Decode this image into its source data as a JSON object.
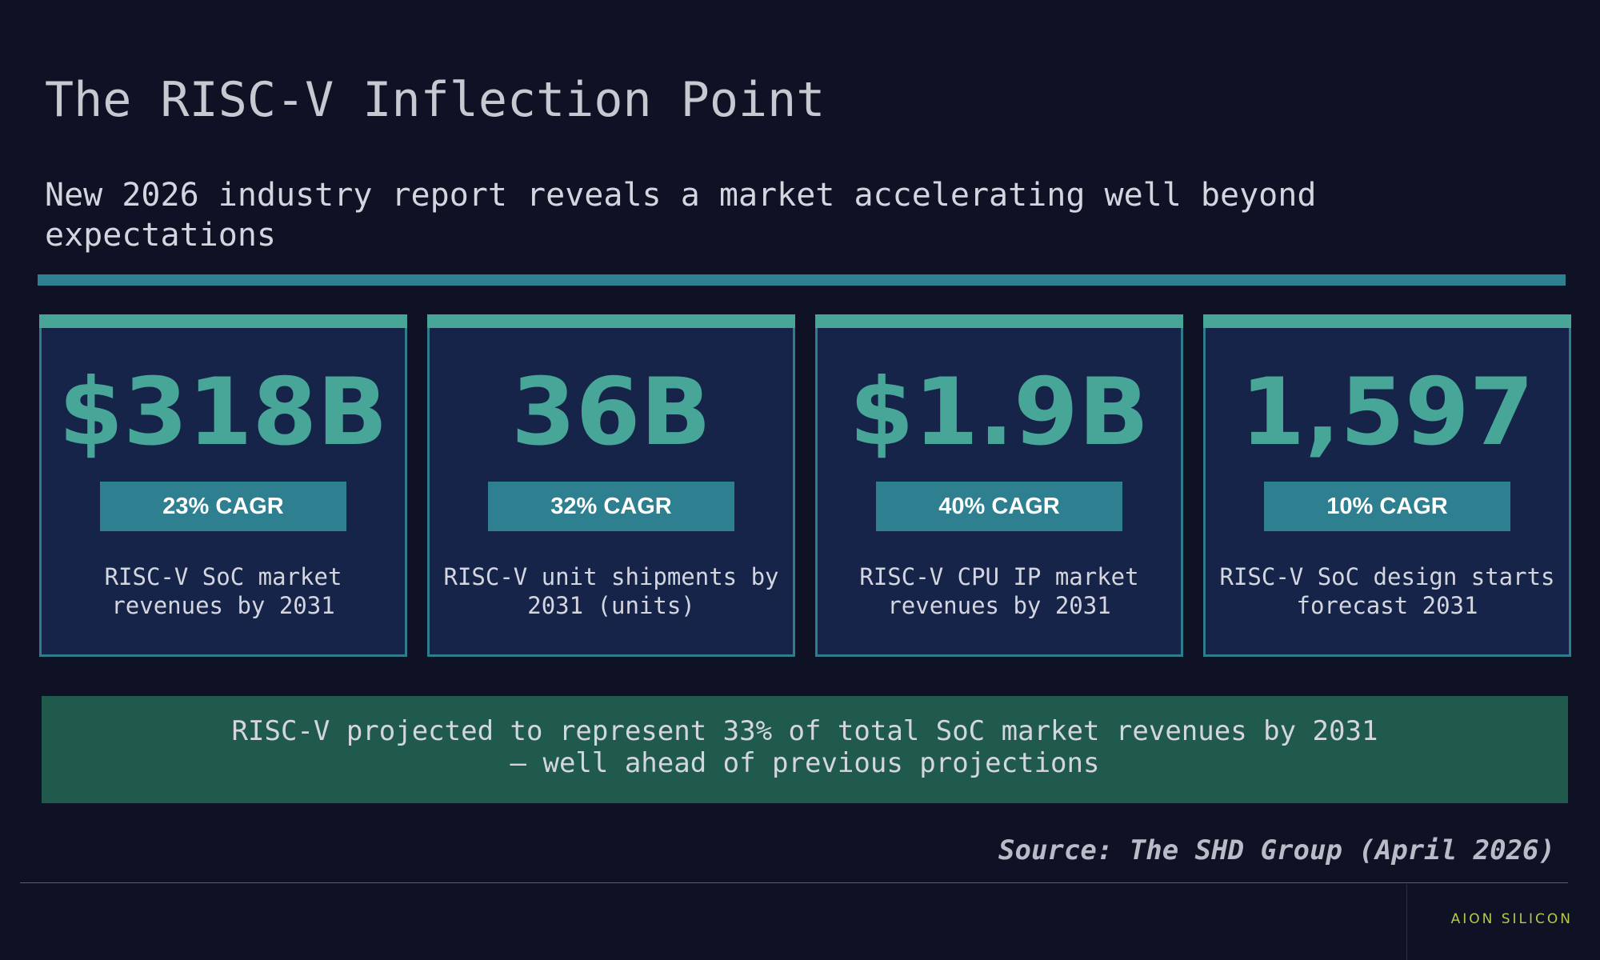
{
  "title": "The RISC-V Inflection Point",
  "subtitle": "New 2026 industry report reveals a market accelerating well beyond expectations",
  "cards": [
    {
      "value": "$318B",
      "badge": "23% CAGR",
      "label": "RISC-V SoC market revenues by 2031"
    },
    {
      "value": "36B",
      "badge": "32% CAGR",
      "label": "RISC-V unit shipments by 2031 (units)"
    },
    {
      "value": "$1.9B",
      "badge": "40% CAGR",
      "label": "RISC-V CPU IP market revenues by 2031"
    },
    {
      "value": "1,597",
      "badge": "10% CAGR",
      "label": "RISC-V SoC design starts forecast 2031"
    }
  ],
  "banner": "RISC-V projected to represent 33% of total SoC market revenues by 2031 — well ahead of previous projections",
  "source": "Source: The SHD Group (April 2026)",
  "brand": "AION SILICON",
  "colors": {
    "background": "#0f1125",
    "card": "#162449",
    "accent_teal": "#47a697",
    "badge": "#2e7f8f",
    "banner": "#1f5a4c",
    "brand": "#b8c94a"
  }
}
